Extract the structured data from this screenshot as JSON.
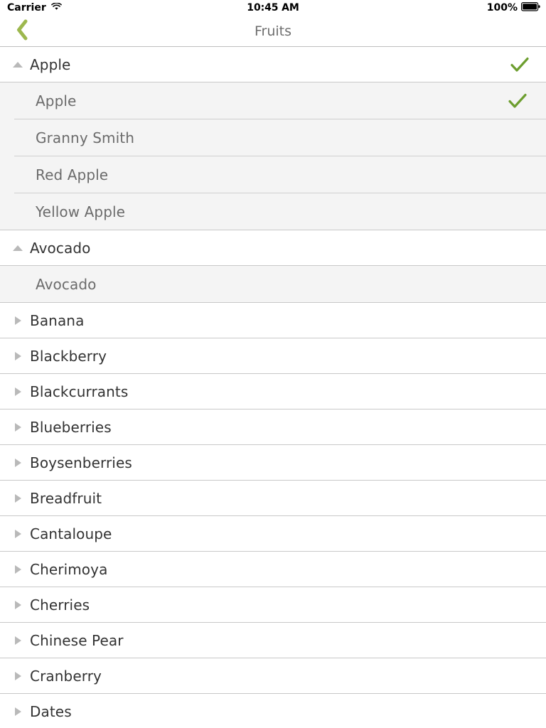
{
  "status_bar": {
    "carrier": "Carrier",
    "wifi_icon": "wifi-icon",
    "time": "10:45 AM",
    "battery_percent": "100%",
    "battery_icon": "battery-full-icon"
  },
  "nav_bar": {
    "back_icon": "back-chevron-icon",
    "title": "Fruits"
  },
  "colors": {
    "accent_green": "#6d9e2f",
    "back_chevron": "#9db84e",
    "title_gray": "#6e6e6e",
    "row_text": "#333333",
    "sub_row_text": "#6b6b6b",
    "sub_row_bg": "#f4f4f4",
    "separator": "#c8c8c8",
    "disclosure_gray": "#b9b9b9"
  },
  "icons": {
    "expanded": "triangle-up-icon",
    "collapsed": "triangle-right-icon",
    "selected": "checkmark-icon"
  },
  "list": {
    "rows": [
      {
        "label": "Apple",
        "type": "group",
        "expanded": true,
        "checked": true,
        "children": [
          {
            "label": "Apple",
            "checked": true
          },
          {
            "label": "Granny Smith",
            "checked": false
          },
          {
            "label": "Red Apple",
            "checked": false
          },
          {
            "label": "Yellow Apple",
            "checked": false
          }
        ]
      },
      {
        "label": "Avocado",
        "type": "group",
        "expanded": true,
        "checked": false,
        "children": [
          {
            "label": "Avocado",
            "checked": false
          }
        ]
      },
      {
        "label": "Banana",
        "type": "group",
        "expanded": false,
        "checked": false,
        "children": []
      },
      {
        "label": "Blackberry",
        "type": "group",
        "expanded": false,
        "checked": false,
        "children": []
      },
      {
        "label": "Blackcurrants",
        "type": "group",
        "expanded": false,
        "checked": false,
        "children": []
      },
      {
        "label": "Blueberries",
        "type": "group",
        "expanded": false,
        "checked": false,
        "children": []
      },
      {
        "label": "Boysenberries",
        "type": "group",
        "expanded": false,
        "checked": false,
        "children": []
      },
      {
        "label": "Breadfruit",
        "type": "group",
        "expanded": false,
        "checked": false,
        "children": []
      },
      {
        "label": "Cantaloupe",
        "type": "group",
        "expanded": false,
        "checked": false,
        "children": []
      },
      {
        "label": "Cherimoya",
        "type": "group",
        "expanded": false,
        "checked": false,
        "children": []
      },
      {
        "label": "Cherries",
        "type": "group",
        "expanded": false,
        "checked": false,
        "children": []
      },
      {
        "label": "Chinese Pear",
        "type": "group",
        "expanded": false,
        "checked": false,
        "children": []
      },
      {
        "label": "Cranberry",
        "type": "group",
        "expanded": false,
        "checked": false,
        "children": []
      },
      {
        "label": "Dates",
        "type": "group",
        "expanded": false,
        "checked": false,
        "children": []
      }
    ]
  }
}
